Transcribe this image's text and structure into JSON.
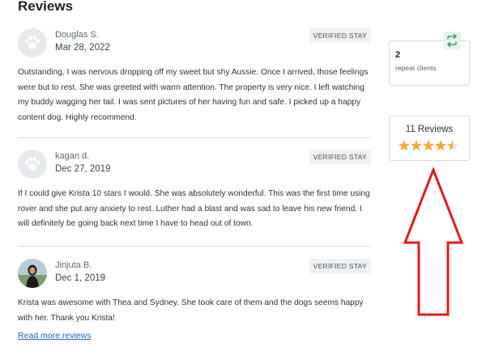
{
  "heading": "Reviews",
  "reviews": [
    {
      "name": "Douglas S.",
      "date": "Mar 28, 2022",
      "badge": "VERIFIED STAY",
      "avatar": "paw-placeholder",
      "text": "Outstanding, I was nervous dropping off my sweet but shy Aussie. Once I arrived, those feelings were but to rest. She was greeted with warm attention. The property is very nice. I left watching my buddy wagging her tail. I was sent pictures of her having fun and safe. I picked up a happy content dog. Highly recommend."
    },
    {
      "name": "kagan d.",
      "date": "Dec 27, 2019",
      "badge": "VERIFIED STAY",
      "avatar": "paw-placeholder",
      "text": "If I could give Krista 10 stars I would. She was absolutely wonderful. This was the first time using rover and she put any anxiety to rest. Luther had a blast and was sad to leave his new friend. I will definitely be going back next time I have to head out of town."
    },
    {
      "name": "Jinjuta B.",
      "date": "Dec 1, 2019",
      "badge": "VERIFIED STAY",
      "avatar": "user-photo",
      "text": "Krista was awesome with Thea and Sydney. She took care of them and the dogs seems happy with her. Thank you Krista!"
    }
  ],
  "read_more": "Read more reviews",
  "repeat_clients": {
    "count": "2",
    "label": "repeat clients",
    "icon": "repeat-icon",
    "icon_color": "#2e9e6b"
  },
  "summary": {
    "reviews_label": "11 Reviews",
    "rating": 4.5,
    "max_rating": 5,
    "star_color": "#f2a93b"
  },
  "annotation": {
    "type": "red-outline-up-arrow",
    "color": "#e31b1b"
  }
}
